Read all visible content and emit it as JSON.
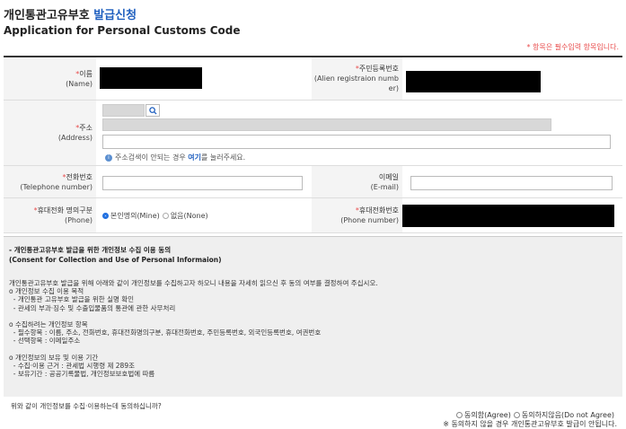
{
  "header": {
    "title_ko_main": "개인통관고유부호",
    "title_ko_highlight": "발급신청",
    "title_en": "Application for Personal Customs Code",
    "required_note": "* 항목은 필수입력 항목입니다."
  },
  "form": {
    "name": {
      "star": "*",
      "label_ko": "이름",
      "label_en": "(Name)"
    },
    "alien_reg": {
      "star": "*",
      "label_ko": "주민등록번호",
      "label_en_1": "(Alien registraion numb",
      "label_en_2": "er)"
    },
    "address": {
      "star": "*",
      "label_ko": "주소",
      "label_en": "(Address)",
      "hint_prefix": "주소검색이 안되는 경우",
      "hint_link": "여기",
      "hint_suffix": "를 눌러주세요."
    },
    "telephone": {
      "star": "*",
      "label_ko": "전화번호",
      "label_en": "(Telephone number)"
    },
    "email": {
      "label_ko": "이메일",
      "label_en": "(E-mail)"
    },
    "phone_owner": {
      "star": "*",
      "label_ko": "휴대전화 명의구분",
      "label_en": "(Phone)",
      "options": [
        "본인명의(Mine)",
        "없음(None)"
      ],
      "selected": "본인명의(Mine)"
    },
    "mobile": {
      "star": "*",
      "label_ko": "휴대전화번호",
      "label_en": "(Phone number)"
    }
  },
  "consent": {
    "title_ko": "- 개인통관고유부호 발급을 위한 개인정보 수집 이용 동의",
    "title_en": "(Consent for Collection and Use of Personal Informaion)",
    "body": "개인통관고유부호 발급을 위해 아래와 같이 개인정보를 수집하고자 하오니 내용을 자세히 읽으신 후 동의 여부를 결정하여 주십시오.\no 개인정보 수집 이용 목적\n  - 개인통관 고유부호 발급을 위한 실명 확인\n  - 관세의 부과·징수 및 수출입물품의 통관에 관한 사무처리\n\no 수집하려는 개인정보 항목\n  - 필수항목 : 이름, 주소, 전화번호, 휴대전화명의구분, 휴대전화번호, 주민등록번호, 외국인등록번호, 여권번호\n  - 선택항목 : 이메일주소\n\no 개인정보의 보유 및 이용 기간\n  - 수집·이용 근거 : 관세법 시행령 제 289조\n  - 보유기간 : 공공기록물법, 개인정보보호법에 따름",
    "question": "위와 같이 개인정보를 수집·이용하는데 동의하십니까?",
    "agree": "동의함(Agree)",
    "disagree": "동의하지않음(Do not Agree)",
    "note": "※ 동의하지 않을 경우 개인통관고유부호 발급이 안됩니다."
  },
  "icons": {
    "search": "search-icon",
    "info": "info-icon"
  },
  "colors": {
    "accent": "#1f5fbf",
    "required": "#e84b4b",
    "radio_selected": "#1f6fe0"
  }
}
